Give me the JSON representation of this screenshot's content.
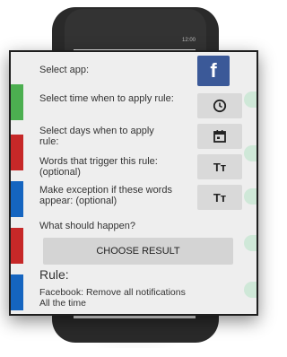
{
  "status_bar": {
    "time": "12:00"
  },
  "dialog": {
    "select_app_label": "Select app:",
    "app_icon": "facebook-icon",
    "app_icon_letter": "f",
    "select_time_label": "Select time when to apply rule:",
    "time_icon": "clock-icon",
    "select_days_label": "Select days when to apply rule:",
    "days_icon": "calendar-icon",
    "words_label": "Words that trigger this rule: (optional)",
    "words_icon": "text-size-icon",
    "words_icon_text": "Tт",
    "exception_label": "Make exception if these words appear: (optional)",
    "exception_icon": "text-size-icon",
    "exception_icon_text": "Tт",
    "what_happen_label": "What should happen?",
    "choose_button": "CHOOSE RESULT",
    "rule_title": "Rule:",
    "rule_line1": "Facebook: Remove all notifications",
    "rule_line2": "All the time"
  },
  "colors": {
    "facebook_blue": "#3b5998",
    "dialog_bg": "#eeeeee",
    "button_bg": "#d9d9d9"
  }
}
